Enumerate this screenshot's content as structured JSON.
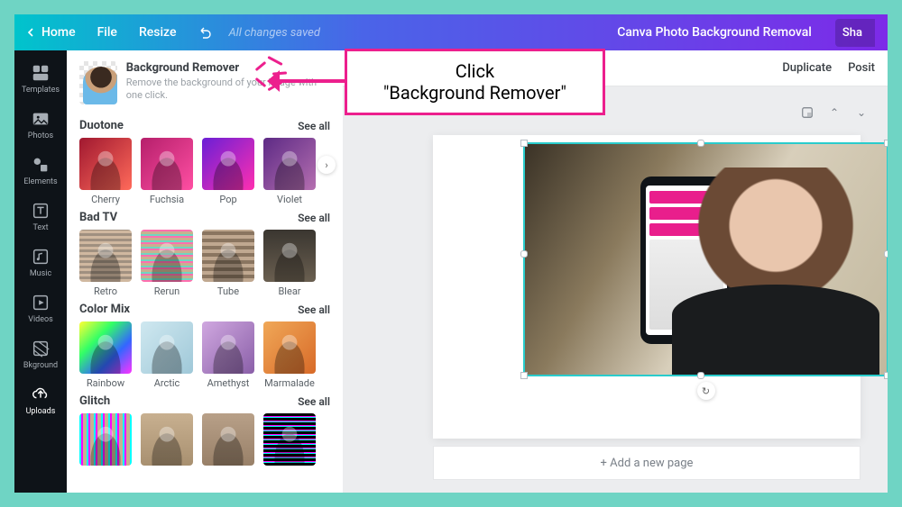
{
  "topbar": {
    "home": "Home",
    "file": "File",
    "resize": "Resize",
    "saved": "All changes saved",
    "title": "Canva Photo Background Removal",
    "share": "Sha"
  },
  "rail": {
    "items": [
      {
        "label": "Templates"
      },
      {
        "label": "Photos"
      },
      {
        "label": "Elements"
      },
      {
        "label": "Text"
      },
      {
        "label": "Music"
      },
      {
        "label": "Videos"
      },
      {
        "label": "Bkground"
      },
      {
        "label": "Uploads"
      }
    ]
  },
  "panel": {
    "bgremover": {
      "title": "Background Remover",
      "desc": "Remove the background of your image with one click."
    },
    "sections": [
      {
        "title": "Duotone",
        "seeall": "See all",
        "items": [
          {
            "label": "Cherry",
            "bg": "linear-gradient(135deg,#a01830,#ff6a5a)"
          },
          {
            "label": "Fuchsia",
            "bg": "linear-gradient(135deg,#b51f6b,#ff4fa3)"
          },
          {
            "label": "Pop",
            "bg": "linear-gradient(135deg,#6a1fd6,#ff2fb0)"
          },
          {
            "label": "Violet",
            "bg": "linear-gradient(135deg,#5d2a85,#b56fb0)"
          }
        ]
      },
      {
        "title": "Bad TV",
        "seeall": "See all",
        "items": [
          {
            "label": "Retro",
            "bg": "repeating-linear-gradient(0deg,#d0b8a0 0 3px,#a09080 3px 6px)"
          },
          {
            "label": "Rerun",
            "bg": "repeating-linear-gradient(0deg,#ff6fae 0 2px,#6fd6c0 2px 4px,#c8b090 4px 7px)"
          },
          {
            "label": "Tube",
            "bg": "repeating-linear-gradient(0deg,#c0a890 0 4px,#8a7560 4px 8px)"
          },
          {
            "label": "Blear",
            "bg": "linear-gradient(#3a3630,#6a5f50)"
          }
        ]
      },
      {
        "title": "Color Mix",
        "seeall": "See all",
        "items": [
          {
            "label": "Rainbow",
            "bg": "linear-gradient(135deg,#ff3,#3f6,#36f,#f3f)"
          },
          {
            "label": "Arctic",
            "bg": "linear-gradient(135deg,#cfe8f0,#9fc8d8)"
          },
          {
            "label": "Amethyst",
            "bg": "linear-gradient(135deg,#d0a8e0,#8a5fa8)"
          },
          {
            "label": "Marmalade",
            "bg": "linear-gradient(135deg,#f0a858,#d86a28)"
          }
        ]
      },
      {
        "title": "Glitch",
        "seeall": "See all",
        "items": [
          {
            "label": "",
            "bg": "repeating-linear-gradient(90deg,#0ff 0 2px,#f0f 2px 4px,#c8b090 4px 8px)"
          },
          {
            "label": "",
            "bg": "linear-gradient(#c8b090,#a89070)"
          },
          {
            "label": "",
            "bg": "linear-gradient(#b8a088,#988068)"
          },
          {
            "label": "",
            "bg": "repeating-linear-gradient(0deg,#000 0 3px,#0ff 3px 4px,#f0f 4px 5px)"
          }
        ]
      }
    ]
  },
  "toolbar": {
    "duplicate": "Duplicate",
    "position": "Posit"
  },
  "stage": {
    "addpage": "+ Add a new page"
  },
  "callout": {
    "line1": "Click",
    "line2": "\"Background Remover\""
  }
}
